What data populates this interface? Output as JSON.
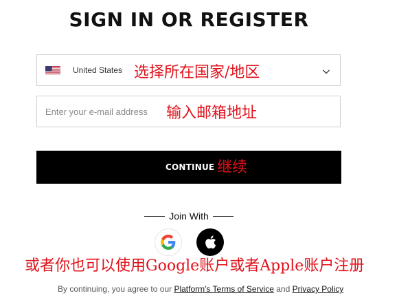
{
  "page": {
    "title": "SIGN IN OR REGISTER"
  },
  "country_select": {
    "selected": "United States",
    "flag_icon": "us-flag-icon"
  },
  "email": {
    "placeholder": "Enter your e-mail address",
    "value": ""
  },
  "continue_button": {
    "label": "CONTINUE"
  },
  "social": {
    "divider_text": "Join With",
    "providers": [
      "Google",
      "Apple"
    ]
  },
  "terms": {
    "prefix": "By continuing, you agree to our",
    "terms_link": "Platform's Terms of Service",
    "and": "and",
    "privacy_link": "Privacy Policy"
  },
  "annotations": {
    "country": "选择所在国家/地区",
    "email": "输入邮箱地址",
    "continue": "继续",
    "social": "或者你也可以使用Google账户或者Apple账户注册"
  },
  "colors": {
    "annotation": "#e0121b",
    "button_bg": "#000000",
    "border": "#cfcfcf"
  }
}
